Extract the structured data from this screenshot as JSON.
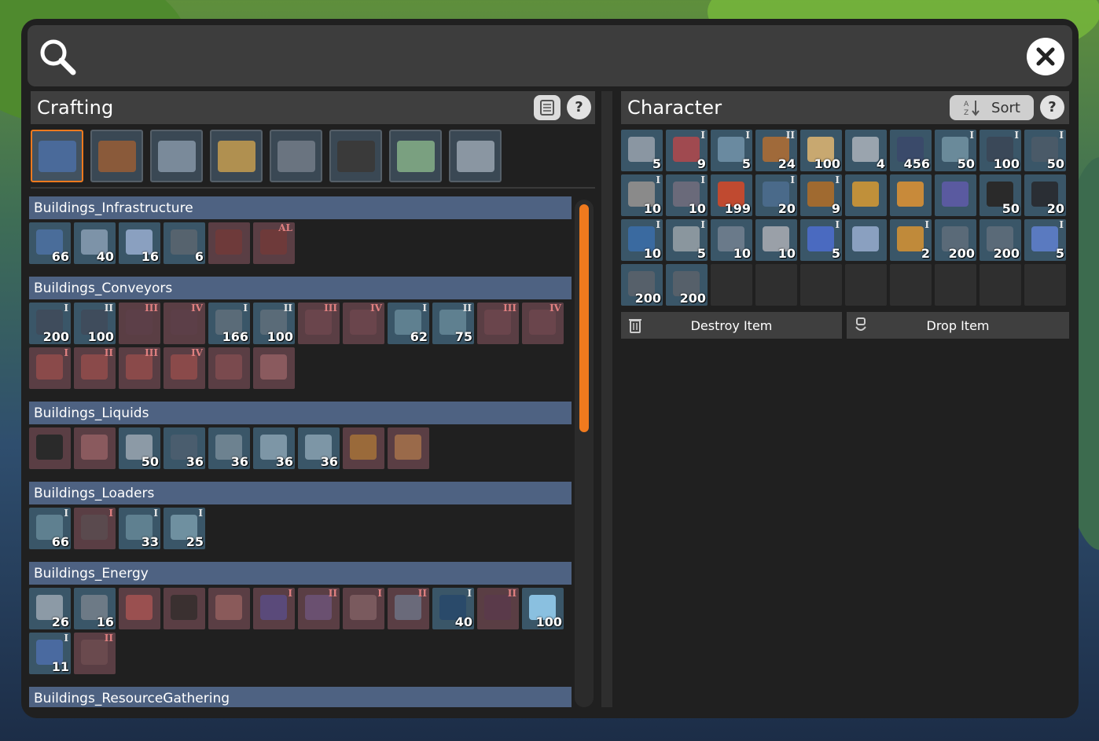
{
  "crafting": {
    "title": "Crafting",
    "help": "?",
    "tabs": [
      {
        "icon": "infrastructure-tab-icon",
        "selected": true
      },
      {
        "icon": "components-tab-icon",
        "selected": false
      },
      {
        "icon": "machines-tab-icon",
        "selected": false
      },
      {
        "icon": "tools-tab-icon",
        "selected": false
      },
      {
        "icon": "plates-tab-icon",
        "selected": false
      },
      {
        "icon": "weapons-tab-icon",
        "selected": false
      },
      {
        "icon": "misc-tab-icon",
        "selected": false
      },
      {
        "icon": "parts-tab-icon",
        "selected": false
      }
    ],
    "categories": [
      {
        "name": "Buildings_Infrastructure",
        "items": [
          {
            "count": "66",
            "tier": "",
            "locked": false,
            "color": "#4a6d9a"
          },
          {
            "count": "40",
            "tier": "",
            "locked": false,
            "color": "#7d93a8"
          },
          {
            "count": "16",
            "tier": "",
            "locked": false,
            "color": "#8aa0c0"
          },
          {
            "count": "6",
            "tier": "",
            "locked": false,
            "color": "#56636e"
          },
          {
            "count": "",
            "tier": "",
            "locked": true,
            "color": "#6e3a3a"
          },
          {
            "count": "",
            "tier": "AL",
            "locked": true,
            "color": "#6e3a3a"
          }
        ]
      },
      {
        "name": "Buildings_Conveyors",
        "items": [
          {
            "count": "200",
            "tier": "I",
            "locked": false,
            "color": "#3f4c5c"
          },
          {
            "count": "100",
            "tier": "II",
            "locked": false,
            "color": "#3f4c5c"
          },
          {
            "count": "",
            "tier": "III",
            "locked": true,
            "color": "#5c3f48"
          },
          {
            "count": "",
            "tier": "IV",
            "locked": true,
            "color": "#5c3f48"
          },
          {
            "count": "166",
            "tier": "I",
            "locked": false,
            "color": "#5a6b78"
          },
          {
            "count": "100",
            "tier": "II",
            "locked": false,
            "color": "#5a6b78"
          },
          {
            "count": "",
            "tier": "III",
            "locked": true,
            "color": "#6a454c"
          },
          {
            "count": "",
            "tier": "IV",
            "locked": true,
            "color": "#6a454c"
          },
          {
            "count": "62",
            "tier": "I",
            "locked": false,
            "color": "#5f8090"
          },
          {
            "count": "75",
            "tier": "II",
            "locked": false,
            "color": "#5f8090"
          },
          {
            "count": "",
            "tier": "III",
            "locked": true,
            "color": "#6a454c"
          },
          {
            "count": "",
            "tier": "IV",
            "locked": true,
            "color": "#6a454c"
          },
          {
            "count": "",
            "tier": "I",
            "locked": true,
            "color": "#8a4a4a"
          },
          {
            "count": "",
            "tier": "II",
            "locked": true,
            "color": "#8a4a4a"
          },
          {
            "count": "",
            "tier": "III",
            "locked": true,
            "color": "#8a4a4a"
          },
          {
            "count": "",
            "tier": "IV",
            "locked": true,
            "color": "#8a4a4a"
          },
          {
            "count": "",
            "tier": "",
            "locked": true,
            "color": "#7a4a4e"
          },
          {
            "count": "",
            "tier": "",
            "locked": true,
            "color": "#8a5a5e"
          }
        ]
      },
      {
        "name": "Buildings_Liquids",
        "items": [
          {
            "count": "",
            "tier": "",
            "locked": true,
            "color": "#2a2a2a"
          },
          {
            "count": "",
            "tier": "",
            "locked": true,
            "color": "#8a5a5e"
          },
          {
            "count": "50",
            "tier": "",
            "locked": false,
            "color": "#8c9aa6"
          },
          {
            "count": "36",
            "tier": "",
            "locked": false,
            "color": "#4a5d6e"
          },
          {
            "count": "36",
            "tier": "",
            "locked": false,
            "color": "#6d8290"
          },
          {
            "count": "36",
            "tier": "",
            "locked": false,
            "color": "#7d96a6"
          },
          {
            "count": "36",
            "tier": "",
            "locked": false,
            "color": "#7d96a6"
          },
          {
            "count": "",
            "tier": "",
            "locked": true,
            "color": "#9a6a3a"
          },
          {
            "count": "",
            "tier": "",
            "locked": true,
            "color": "#9a6a4a"
          }
        ]
      },
      {
        "name": "Buildings_Loaders",
        "items": [
          {
            "count": "66",
            "tier": "I",
            "locked": false,
            "color": "#5f8090"
          },
          {
            "count": "",
            "tier": "I",
            "locked": true,
            "color": "#5a4a4e"
          },
          {
            "count": "33",
            "tier": "I",
            "locked": false,
            "color": "#5f8090"
          },
          {
            "count": "25",
            "tier": "I",
            "locked": false,
            "color": "#6f90a0"
          }
        ]
      },
      {
        "name": "Buildings_Energy",
        "items": [
          {
            "count": "26",
            "tier": "",
            "locked": false,
            "color": "#8c9aa6"
          },
          {
            "count": "16",
            "tier": "",
            "locked": false,
            "color": "#6d7a86"
          },
          {
            "count": "",
            "tier": "",
            "locked": true,
            "color": "#9a5050"
          },
          {
            "count": "",
            "tier": "",
            "locked": true,
            "color": "#3a3030"
          },
          {
            "count": "",
            "tier": "",
            "locked": true,
            "color": "#8a5a5a"
          },
          {
            "count": "",
            "tier": "I",
            "locked": true,
            "color": "#5a4a7a"
          },
          {
            "count": "",
            "tier": "II",
            "locked": true,
            "color": "#6a5070"
          },
          {
            "count": "",
            "tier": "I",
            "locked": true,
            "color": "#7a5a5e"
          },
          {
            "count": "",
            "tier": "II",
            "locked": true,
            "color": "#6a6a7a"
          },
          {
            "count": "40",
            "tier": "I",
            "locked": false,
            "color": "#2a4a6a"
          },
          {
            "count": "",
            "tier": "II",
            "locked": true,
            "color": "#5a3a4a"
          },
          {
            "count": "100",
            "tier": "",
            "locked": false,
            "color": "#8ac0e0"
          },
          {
            "count": "11",
            "tier": "I",
            "locked": false,
            "color": "#4a6aa0"
          },
          {
            "count": "",
            "tier": "II",
            "locked": true,
            "color": "#6a4a4e"
          }
        ]
      },
      {
        "name": "Buildings_ResourceGathering",
        "items": []
      }
    ]
  },
  "character": {
    "title": "Character",
    "sort_label": "Sort",
    "help": "?",
    "slots": [
      {
        "count": "5",
        "tier": "",
        "color": "#8a96a2"
      },
      {
        "count": "9",
        "tier": "I",
        "color": "#a04a50"
      },
      {
        "count": "5",
        "tier": "I",
        "color": "#6a8aa0"
      },
      {
        "count": "24",
        "tier": "II",
        "color": "#a06a3a"
      },
      {
        "count": "100",
        "tier": "",
        "color": "#c8a870"
      },
      {
        "count": "4",
        "tier": "",
        "color": "#9aa4ae"
      },
      {
        "count": "456",
        "tier": "",
        "color": "#3a4a6a"
      },
      {
        "count": "50",
        "tier": "I",
        "color": "#6a8a9a"
      },
      {
        "count": "100",
        "tier": "I",
        "color": "#3a4858"
      },
      {
        "count": "50",
        "tier": "I",
        "color": "#4a5a68"
      },
      {
        "count": "10",
        "tier": "I",
        "color": "#8a8a8a"
      },
      {
        "count": "10",
        "tier": "I",
        "color": "#6a6a7a"
      },
      {
        "count": "199",
        "tier": "",
        "color": "#c04a30"
      },
      {
        "count": "20",
        "tier": "I",
        "color": "#4a6a8a"
      },
      {
        "count": "9",
        "tier": "I",
        "color": "#a06a30"
      },
      {
        "count": "",
        "tier": "",
        "color": "#c0903a"
      },
      {
        "count": "",
        "tier": "",
        "color": "#c88a3a"
      },
      {
        "count": "",
        "tier": "",
        "color": "#5a5aa0"
      },
      {
        "count": "50",
        "tier": "",
        "color": "#2a2a2a"
      },
      {
        "count": "20",
        "tier": "",
        "color": "#2a2e34"
      },
      {
        "count": "10",
        "tier": "I",
        "color": "#3a6aa0"
      },
      {
        "count": "5",
        "tier": "I",
        "color": "#8a969e"
      },
      {
        "count": "10",
        "tier": "",
        "color": "#6a7a8a"
      },
      {
        "count": "10",
        "tier": "",
        "color": "#9aa0a8"
      },
      {
        "count": "5",
        "tier": "I",
        "color": "#4a6ac0"
      },
      {
        "count": "",
        "tier": "",
        "color": "#8aa0c0"
      },
      {
        "count": "2",
        "tier": "I",
        "color": "#c08a3a"
      },
      {
        "count": "200",
        "tier": "",
        "color": "#5a6a78"
      },
      {
        "count": "200",
        "tier": "",
        "color": "#5a6a78"
      },
      {
        "count": "5",
        "tier": "I",
        "color": "#5a7ac0"
      },
      {
        "count": "200",
        "tier": "",
        "color": "#56606a"
      },
      {
        "count": "200",
        "tier": "",
        "color": "#56606a"
      },
      {
        "count": "",
        "tier": "",
        "color": ""
      },
      {
        "count": "",
        "tier": "",
        "color": ""
      },
      {
        "count": "",
        "tier": "",
        "color": ""
      },
      {
        "count": "",
        "tier": "",
        "color": ""
      },
      {
        "count": "",
        "tier": "",
        "color": ""
      },
      {
        "count": "",
        "tier": "",
        "color": ""
      },
      {
        "count": "",
        "tier": "",
        "color": ""
      },
      {
        "count": "",
        "tier": "",
        "color": ""
      }
    ],
    "destroy_label": "Destroy Item",
    "drop_label": "Drop Item"
  },
  "colors": {
    "accent": "#f07a1e",
    "category_header": "#4e6282",
    "slot_bg": "#3a5668",
    "locked_bg": "#5a3e44"
  }
}
